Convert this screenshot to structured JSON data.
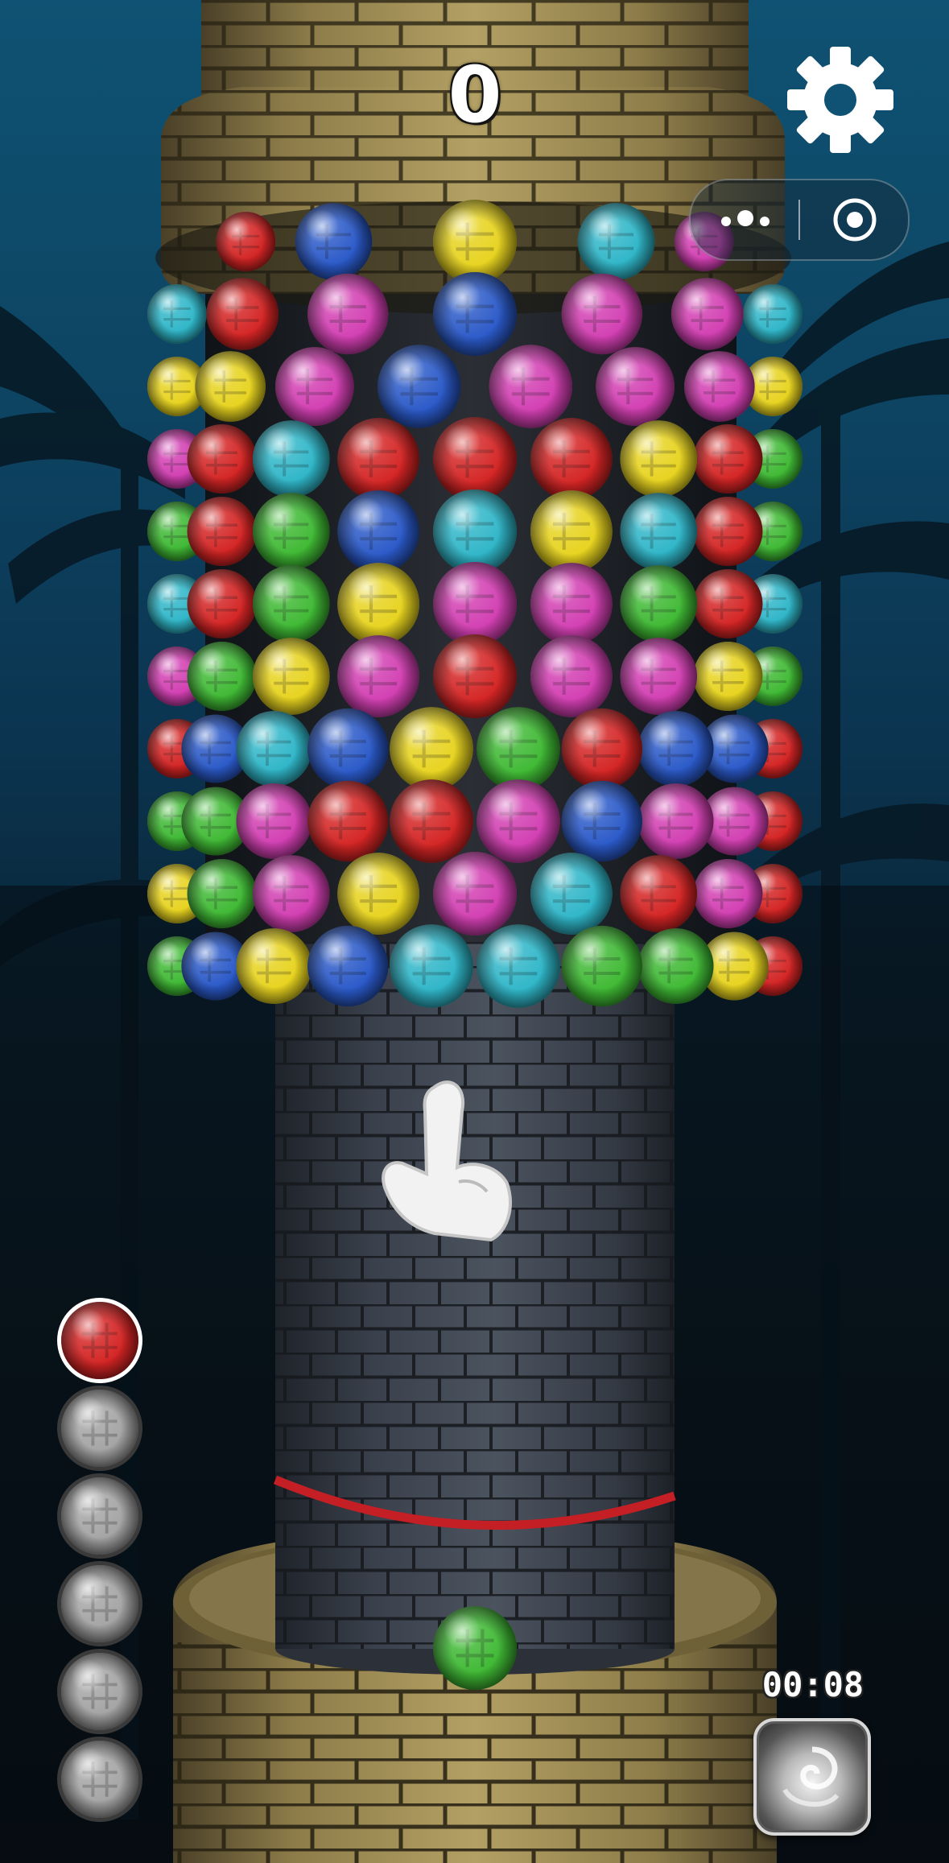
{
  "hud": {
    "score": "0",
    "timer": "00:08",
    "settings_icon": "gear-icon",
    "menu_icon": "more-dots-icon",
    "close_icon": "target-circle-icon",
    "powerup_icon": "silver-swirl-ball-icon",
    "tutorial_icon": "pointing-hand-icon"
  },
  "ammo_queue": [
    "red",
    "gray",
    "gray",
    "gray",
    "gray",
    "gray"
  ],
  "launcher_ball": "green",
  "ball_colors": {
    "red": "#d42424",
    "blue": "#2a59c8",
    "yellow": "#e7d31f",
    "cyan": "#2fb6c8",
    "magenta": "#d23fb2",
    "green": "#3fb934",
    "gray": "#a4a4a4"
  },
  "tower_balls": [
    [
      "red",
      "blue",
      "yellow",
      "cyan",
      "magenta"
    ],
    [
      "cyan",
      "red",
      "magenta",
      "blue",
      "magenta",
      "magenta",
      "cyan"
    ],
    [
      "yellow",
      "yellow",
      "magenta",
      "blue",
      "magenta",
      "magenta",
      "magenta",
      "yellow"
    ],
    [
      "magenta",
      "red",
      "cyan",
      "red",
      "red",
      "red",
      "yellow",
      "red",
      "green"
    ],
    [
      "green",
      "red",
      "green",
      "blue",
      "cyan",
      "yellow",
      "cyan",
      "red",
      "green"
    ],
    [
      "cyan",
      "red",
      "green",
      "yellow",
      "magenta",
      "magenta",
      "green",
      "red",
      "cyan"
    ],
    [
      "magenta",
      "green",
      "yellow",
      "magenta",
      "red",
      "magenta",
      "magenta",
      "yellow",
      "green"
    ],
    [
      "red",
      "blue",
      "cyan",
      "blue",
      "yellow",
      "green",
      "red",
      "blue",
      "blue",
      "red"
    ],
    [
      "green",
      "green",
      "magenta",
      "red",
      "red",
      "magenta",
      "blue",
      "magenta",
      "magenta",
      "red"
    ],
    [
      "yellow",
      "green",
      "magenta",
      "yellow",
      "magenta",
      "cyan",
      "red",
      "magenta",
      "red"
    ],
    [
      "green",
      "blue",
      "yellow",
      "blue",
      "cyan",
      "cyan",
      "green",
      "green",
      "yellow",
      "red"
    ]
  ]
}
